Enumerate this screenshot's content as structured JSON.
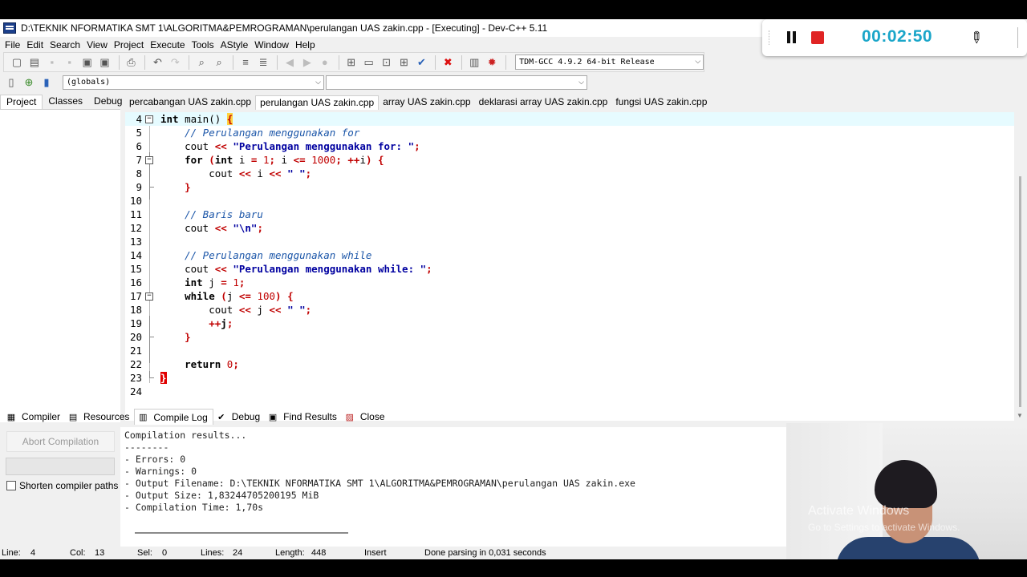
{
  "window": {
    "title": "D:\\TEKNIK NFORMATIKA SMT 1\\ALGORITMA&PEMROGRAMAN\\perulangan UAS zakin.cpp - [Executing] - Dev-C++ 5.11"
  },
  "menu": [
    "File",
    "Edit",
    "Search",
    "View",
    "Project",
    "Execute",
    "Tools",
    "AStyle",
    "Window",
    "Help"
  ],
  "toolbar": {
    "compiler_select": "TDM-GCC 4.9.2 64-bit Release",
    "icons": [
      "new-file-icon",
      "open-icon",
      "save-icon",
      "save-all-icon",
      "close-file-icon",
      "close-all-icon",
      "print-icon",
      "undo-icon",
      "redo-icon",
      "find-icon",
      "replace-icon",
      "indent-icon",
      "unindent-icon",
      "back-icon",
      "forward-icon",
      "bookmark-icon",
      "compile-icon",
      "run-icon",
      "compile-run-icon",
      "rebuild-icon",
      "check-syntax-icon",
      "stop-icon",
      "chart-icon",
      "debug-icon"
    ]
  },
  "toolbar2": {
    "scope_select": "(globals)",
    "member_select": ""
  },
  "left_panel": {
    "tabs": [
      "Project",
      "Classes",
      "Debug"
    ],
    "active_tab": "Project"
  },
  "file_tabs": [
    {
      "label": "percabangan UAS zakin.cpp",
      "active": false
    },
    {
      "label": "perulangan UAS zakin.cpp",
      "active": true
    },
    {
      "label": "array UAS zakin.cpp",
      "active": false
    },
    {
      "label": "deklarasi array UAS zakin.cpp",
      "active": false
    },
    {
      "label": "fungsi UAS zakin.cpp",
      "active": false
    }
  ],
  "editor": {
    "lines": [
      {
        "no": "4",
        "tokens": [
          {
            "t": "int",
            "c": "kw"
          },
          {
            "t": " main() ",
            "c": ""
          },
          {
            "t": "{",
            "c": "brk-hl"
          }
        ]
      },
      {
        "no": "5",
        "tokens": [
          {
            "t": "    // Perulangan menggunakan for",
            "c": "cm"
          }
        ]
      },
      {
        "no": "6",
        "tokens": [
          {
            "t": "    cout ",
            "c": ""
          },
          {
            "t": "<<",
            "c": "op"
          },
          {
            "t": " ",
            "c": ""
          },
          {
            "t": "\"Perulangan menggunakan for: \"",
            "c": "st"
          },
          {
            "t": ";",
            "c": "op"
          }
        ]
      },
      {
        "no": "7",
        "tokens": [
          {
            "t": "    ",
            "c": ""
          },
          {
            "t": "for",
            "c": "kw"
          },
          {
            "t": " ",
            "c": ""
          },
          {
            "t": "(",
            "c": "op"
          },
          {
            "t": "int",
            "c": "kw"
          },
          {
            "t": " i ",
            "c": ""
          },
          {
            "t": "=",
            "c": "op"
          },
          {
            "t": " ",
            "c": ""
          },
          {
            "t": "1",
            "c": "nm"
          },
          {
            "t": ";",
            "c": "op"
          },
          {
            "t": " i ",
            "c": ""
          },
          {
            "t": "<=",
            "c": "op"
          },
          {
            "t": " ",
            "c": ""
          },
          {
            "t": "1000",
            "c": "nm"
          },
          {
            "t": ";",
            "c": "op"
          },
          {
            "t": " ",
            "c": ""
          },
          {
            "t": "++",
            "c": "op"
          },
          {
            "t": "i",
            "c": ""
          },
          {
            "t": ")",
            "c": "op"
          },
          {
            "t": " ",
            "c": ""
          },
          {
            "t": "{",
            "c": "brk"
          }
        ]
      },
      {
        "no": "8",
        "tokens": [
          {
            "t": "        cout ",
            "c": ""
          },
          {
            "t": "<<",
            "c": "op"
          },
          {
            "t": " i ",
            "c": ""
          },
          {
            "t": "<<",
            "c": "op"
          },
          {
            "t": " ",
            "c": ""
          },
          {
            "t": "\" \"",
            "c": "st"
          },
          {
            "t": ";",
            "c": "op"
          }
        ]
      },
      {
        "no": "9",
        "tokens": [
          {
            "t": "    ",
            "c": ""
          },
          {
            "t": "}",
            "c": "brk"
          }
        ]
      },
      {
        "no": "10",
        "tokens": []
      },
      {
        "no": "11",
        "tokens": [
          {
            "t": "    // Baris baru",
            "c": "cm"
          }
        ]
      },
      {
        "no": "12",
        "tokens": [
          {
            "t": "    cout ",
            "c": ""
          },
          {
            "t": "<<",
            "c": "op"
          },
          {
            "t": " ",
            "c": ""
          },
          {
            "t": "\"\\n\"",
            "c": "st"
          },
          {
            "t": ";",
            "c": "op"
          }
        ]
      },
      {
        "no": "13",
        "tokens": []
      },
      {
        "no": "14",
        "tokens": [
          {
            "t": "    // Perulangan menggunakan while",
            "c": "cm"
          }
        ]
      },
      {
        "no": "15",
        "tokens": [
          {
            "t": "    cout ",
            "c": ""
          },
          {
            "t": "<<",
            "c": "op"
          },
          {
            "t": " ",
            "c": ""
          },
          {
            "t": "\"Perulangan menggunakan while: \"",
            "c": "st"
          },
          {
            "t": ";",
            "c": "op"
          }
        ]
      },
      {
        "no": "16",
        "tokens": [
          {
            "t": "    ",
            "c": ""
          },
          {
            "t": "int",
            "c": "kw"
          },
          {
            "t": " j ",
            "c": ""
          },
          {
            "t": "=",
            "c": "op"
          },
          {
            "t": " ",
            "c": ""
          },
          {
            "t": "1",
            "c": "nm"
          },
          {
            "t": ";",
            "c": "op"
          }
        ]
      },
      {
        "no": "17",
        "tokens": [
          {
            "t": "    ",
            "c": ""
          },
          {
            "t": "while",
            "c": "kw"
          },
          {
            "t": " ",
            "c": ""
          },
          {
            "t": "(",
            "c": "op"
          },
          {
            "t": "j ",
            "c": ""
          },
          {
            "t": "<=",
            "c": "op"
          },
          {
            "t": " ",
            "c": ""
          },
          {
            "t": "100",
            "c": "nm"
          },
          {
            "t": ")",
            "c": "op"
          },
          {
            "t": " ",
            "c": ""
          },
          {
            "t": "{",
            "c": "brk"
          }
        ]
      },
      {
        "no": "18",
        "tokens": [
          {
            "t": "        cout ",
            "c": ""
          },
          {
            "t": "<<",
            "c": "op"
          },
          {
            "t": " j ",
            "c": ""
          },
          {
            "t": "<<",
            "c": "op"
          },
          {
            "t": " ",
            "c": ""
          },
          {
            "t": "\" \"",
            "c": "st"
          },
          {
            "t": ";",
            "c": "op"
          }
        ]
      },
      {
        "no": "19",
        "tokens": [
          {
            "t": "        ",
            "c": ""
          },
          {
            "t": "++",
            "c": "op"
          },
          {
            "t": "j",
            "c": "kw"
          },
          {
            "t": ";",
            "c": "op"
          }
        ]
      },
      {
        "no": "20",
        "tokens": [
          {
            "t": "    ",
            "c": ""
          },
          {
            "t": "}",
            "c": "brk"
          }
        ]
      },
      {
        "no": "21",
        "tokens": []
      },
      {
        "no": "22",
        "tokens": [
          {
            "t": "    ",
            "c": ""
          },
          {
            "t": "return",
            "c": "kw"
          },
          {
            "t": " ",
            "c": ""
          },
          {
            "t": "0",
            "c": "nm"
          },
          {
            "t": ";",
            "c": "op"
          }
        ]
      },
      {
        "no": "23",
        "tokens": [
          {
            "t": "}",
            "c": "brk-err"
          }
        ]
      },
      {
        "no": "24",
        "tokens": []
      }
    ],
    "current_line": "4"
  },
  "bottom_panel": {
    "tabs": [
      {
        "label": "Compiler",
        "icon": "compiler-grid-icon"
      },
      {
        "label": "Resources",
        "icon": "resources-icon"
      },
      {
        "label": "Compile Log",
        "icon": "compile-log-chart-icon",
        "active": true
      },
      {
        "label": "Debug",
        "icon": "debug-check-icon"
      },
      {
        "label": "Find Results",
        "icon": "find-results-icon"
      },
      {
        "label": "Close",
        "icon": "close-panel-icon"
      }
    ],
    "abort_button": "Abort Compilation",
    "shorten_paths_label": "Shorten compiler paths",
    "log": "Compilation results...\n--------\n- Errors: 0\n- Warnings: 0\n- Output Filename: D:\\TEKNIK NFORMATIKA SMT 1\\ALGORITMA&PEMROGRAMAN\\perulangan UAS zakin.exe\n- Output Size: 1,83244705200195 MiB\n- Compilation Time: 1,70s"
  },
  "status": {
    "line_label": "Line:",
    "line_value": "4",
    "col_label": "Col:",
    "col_value": "13",
    "sel_label": "Sel:",
    "sel_value": "0",
    "lines_label": "Lines:",
    "lines_value": "24",
    "length_label": "Length:",
    "length_value": "448",
    "mode": "Insert",
    "message": "Done parsing in 0,031 seconds"
  },
  "recorder": {
    "time": "00:02:50"
  },
  "watermark": {
    "title": "Activate Windows",
    "subtitle": "Go to Settings to activate Windows."
  }
}
